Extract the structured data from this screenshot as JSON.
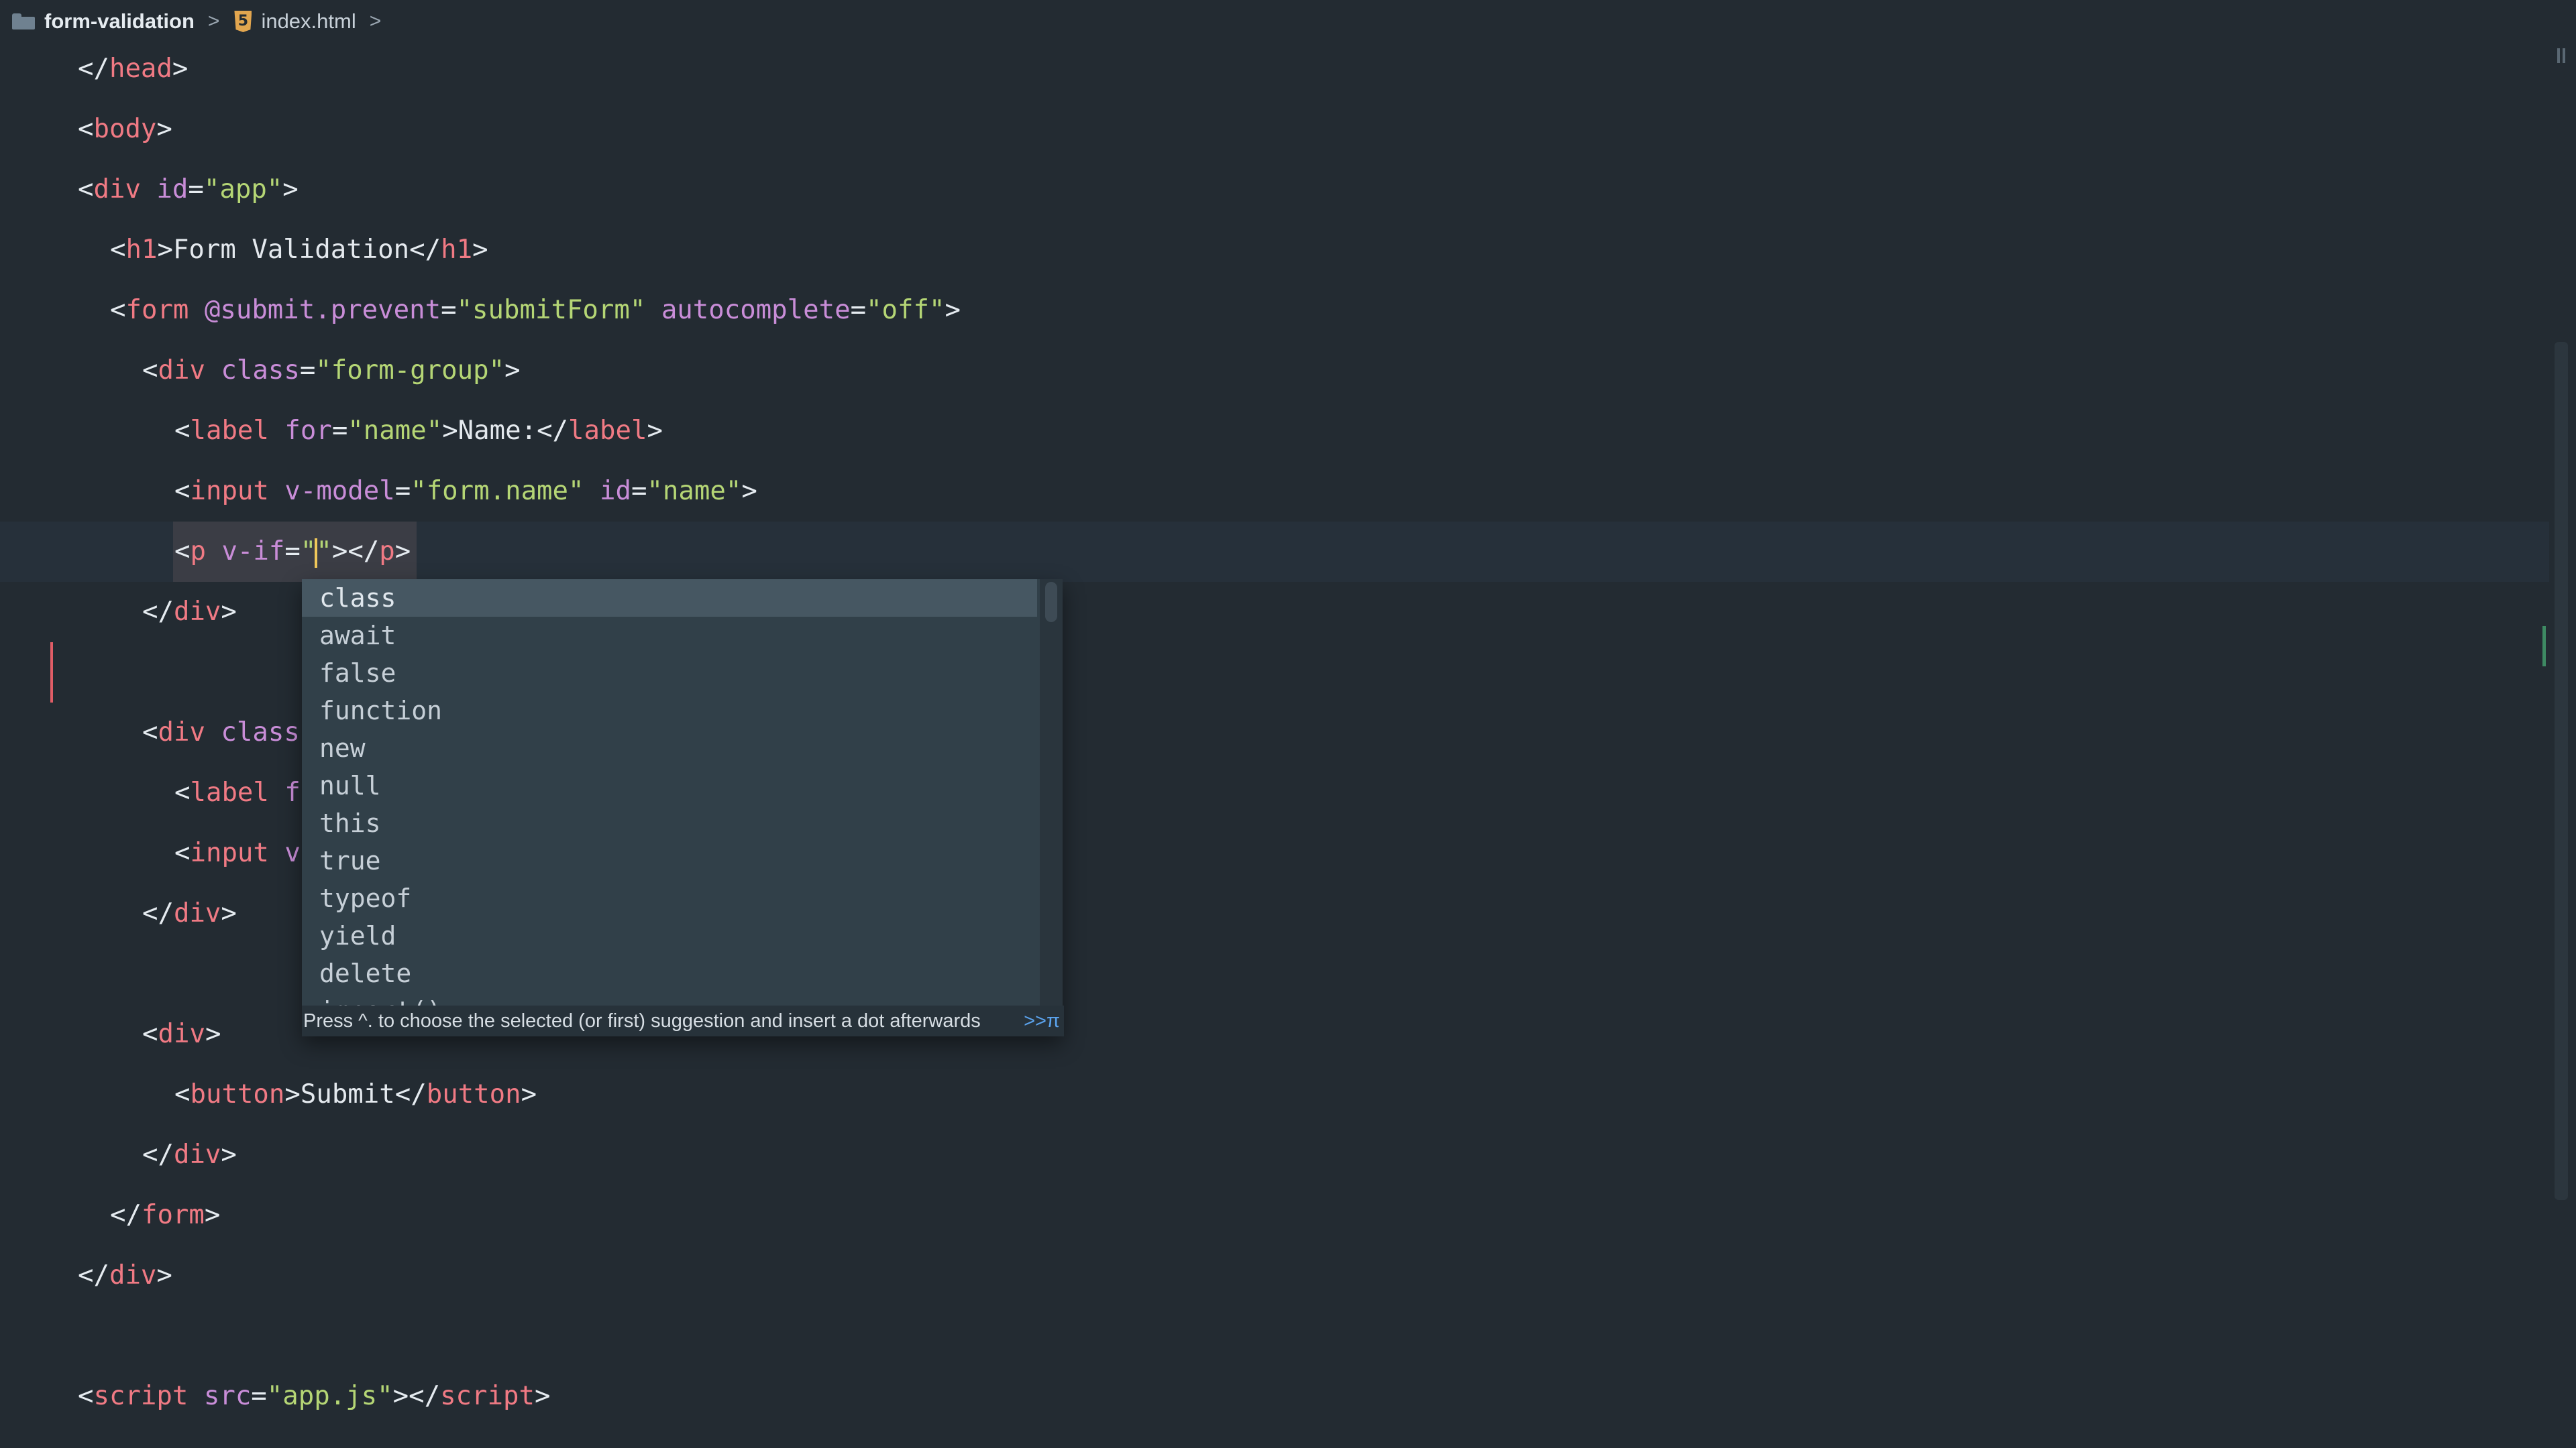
{
  "breadcrumb": {
    "folder_icon": "folder-icon",
    "folder": "form-validation",
    "sep1": ">",
    "file_icon": "html5-icon",
    "file": "index.html",
    "sep2": ">"
  },
  "colors": {
    "tag": "#f07a84",
    "attr": "#c98dd8",
    "string": "#b5d675",
    "text": "#e4e9ee",
    "background": "#232b32",
    "current_line": "#26303a",
    "autocomplete_bg": "#314049",
    "autocomplete_selected": "#465762",
    "caret": "#f0c85a"
  },
  "editor": {
    "lines": {
      "l1": {
        "p1": "</",
        "t1": "head",
        "p2": ">"
      },
      "l2": {
        "p1": "<",
        "t1": "body",
        "p2": ">"
      },
      "l3": {
        "p1": "<",
        "t1": "div",
        "a1": " id",
        "p2": "=",
        "s1": "\"app\"",
        "p3": ">"
      },
      "l4": {
        "p1": "<",
        "t1": "h1",
        "p2": ">",
        "x1": "Form Validation",
        "p3": "</",
        "t2": "h1",
        "p4": ">"
      },
      "l5": {
        "p1": "<",
        "t1": "form",
        "a1": " @submit.prevent",
        "p2": "=",
        "s1": "\"submitForm\"",
        "a2": " autocomplete",
        "p3": "=",
        "s2": "\"off\"",
        "p4": ">"
      },
      "l6": {
        "p1": "<",
        "t1": "div",
        "a1": " class",
        "p2": "=",
        "s1": "\"form-group\"",
        "p3": ">"
      },
      "l7": {
        "p1": "<",
        "t1": "label",
        "a1": " for",
        "p2": "=",
        "s1": "\"name\"",
        "p3": ">",
        "x1": "Name:",
        "p4": "</",
        "t2": "label",
        "p5": ">"
      },
      "l8": {
        "p1": "<",
        "t1": "input",
        "a1": " v-model",
        "p2": "=",
        "s1": "\"form.name\"",
        "a2": " id",
        "p3": "=",
        "s2": "\"name\"",
        "p4": ">"
      },
      "l9": {
        "p1": "<",
        "t1": "p",
        "a1": " v-if",
        "p2": "=",
        "s1": "\"",
        "s2": "\"",
        "p3": ">",
        "p4": "</",
        "t2": "p",
        "p5": ">"
      },
      "l10": {
        "p1": "</",
        "t1": "div",
        "p2": ">"
      },
      "l11": {
        "p1": "<",
        "t1": "div",
        "a1": " class"
      },
      "l12": {
        "p1": "<",
        "t1": "label",
        "a1": " f"
      },
      "l13": {
        "p1": "<",
        "t1": "input",
        "a1": " v"
      },
      "l14": {
        "p1": "</",
        "t1": "div",
        "p2": ">"
      },
      "l15": {
        "p1": "<",
        "t1": "div",
        "p2": ">"
      },
      "l16": {
        "p1": "<",
        "t1": "button",
        "p2": ">",
        "x1": "Submit",
        "p3": "</",
        "t2": "button",
        "p4": ">"
      },
      "l17": {
        "p1": "</",
        "t1": "div",
        "p2": ">"
      },
      "l18": {
        "p1": "</",
        "t1": "form",
        "p2": ">"
      },
      "l19": {
        "p1": "</",
        "t1": "div",
        "p2": ">"
      },
      "l20": {
        "p1": "<",
        "t1": "script",
        "a1": " src",
        "p2": "=",
        "s1": "\"app.js\"",
        "p3": ">",
        "p4": "</",
        "t2": "script",
        "p5": ">"
      }
    }
  },
  "autocomplete": {
    "items": [
      "class",
      "await",
      "false",
      "function",
      "new",
      "null",
      "this",
      "true",
      "typeof",
      "yield",
      "delete",
      "import()"
    ],
    "selected_index": 0,
    "footer": "Press ^. to choose the selected (or first) suggestion and insert a dot afterwards",
    "footer_link": ">>π"
  },
  "gutter": {
    "pause_icon": "pause-icon"
  }
}
